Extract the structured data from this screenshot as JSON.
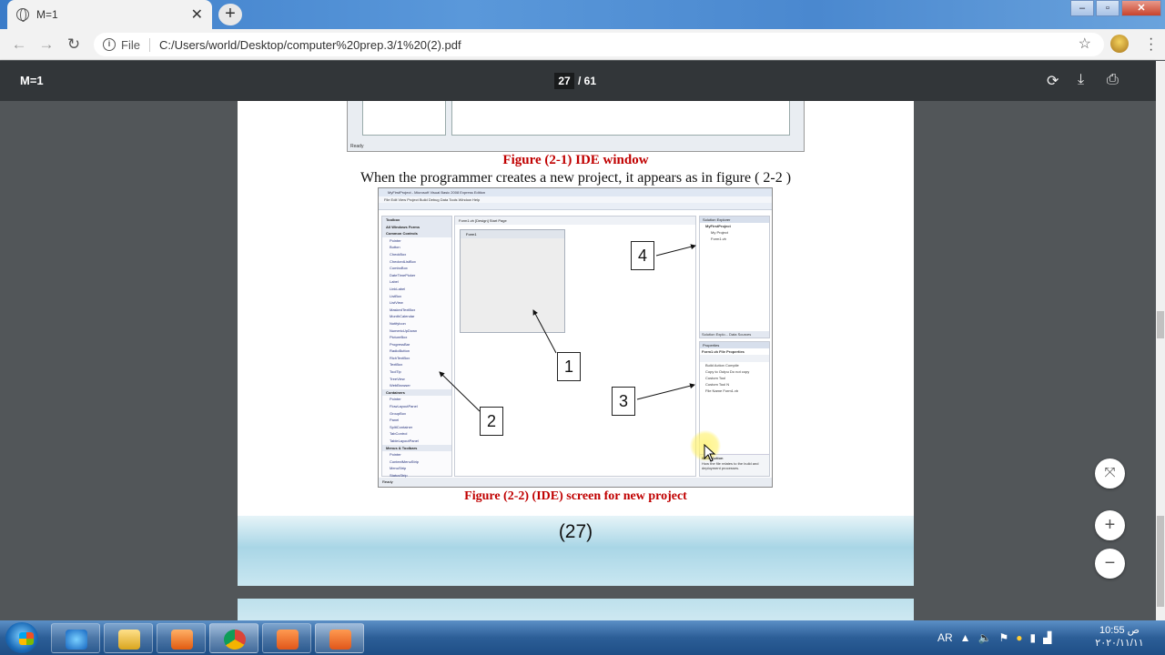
{
  "browser": {
    "tab_title": "M=1",
    "tab_close": "✕",
    "new_tab": "+",
    "omnibox_scheme": "File",
    "omnibox_url": "C:/Users/world/Desktop/computer%20prep.3/1%20(2).pdf"
  },
  "pdf_toolbar": {
    "title": "M=1",
    "current_page": "27",
    "total_pages": "/ 61"
  },
  "page": {
    "fig1_status": "Ready",
    "fig1_caption": "Figure (2-1) IDE window",
    "body_text": "When the programmer creates a new project, it appears as in figure ( 2-2 )",
    "fig2_caption": "Figure (2-2) (IDE) screen for new project",
    "page_number": "(27)",
    "callouts": [
      "1",
      "2",
      "3",
      "4"
    ]
  },
  "ide": {
    "title": "MyFirstProject - Microsoft Visual Basic 2008 Express Edition",
    "menu": "File  Edit  View  Project  Build  Debug  Data  Tools  Window  Help",
    "toolbox_title": "Toolbox",
    "toolbox_items": [
      "All Windows Forms",
      "Common Controls",
      "Pointer",
      "Button",
      "CheckBox",
      "CheckedListBox",
      "ComboBox",
      "DateTimePicker",
      "Label",
      "LinkLabel",
      "ListBox",
      "ListView",
      "MaskedTextBox",
      "MonthCalendar",
      "NotifyIcon",
      "NumericUpDown",
      "PictureBox",
      "ProgressBar",
      "RadioButton",
      "RichTextBox",
      "TextBox",
      "ToolTip",
      "TreeView",
      "WebBrowser",
      "Containers",
      "Pointer",
      "FlowLayoutPanel",
      "GroupBox",
      "Panel",
      "SplitContainer",
      "TabControl",
      "TableLayoutPanel",
      "Menus & Toolbars",
      "Pointer",
      "ContextMenuStrip",
      "MenuStrip",
      "StatusStrip"
    ],
    "designer_tabs": "Form1.vb [Design]   Start Page",
    "form_title": "Form1",
    "solution_title": "Solution Explorer",
    "solution_items": [
      "MyFirstProject",
      "My Project",
      "Form1.vb"
    ],
    "solution_tabs": "Solution Explo...  Data Sources",
    "props_title": "Properties",
    "props_subtitle": "Form1.vb File Properties",
    "props_rows": [
      "Build Action    Compile",
      "Copy to Outpu Do not copy",
      "Custom Tool",
      "Custom Tool N",
      "File Name       Form1.vb"
    ],
    "props_desc_title": "Build Action",
    "props_desc": "How the file relates to the build and deployment processes.",
    "status": "Ready"
  },
  "taskbar": {
    "lang": "AR",
    "time": "10:55 ص",
    "date": "٢٠٢٠/١١/١١"
  },
  "colors": {
    "caption_red": "#c00000",
    "pdf_toolbar": "#323639",
    "viewer_bg": "#525659"
  }
}
